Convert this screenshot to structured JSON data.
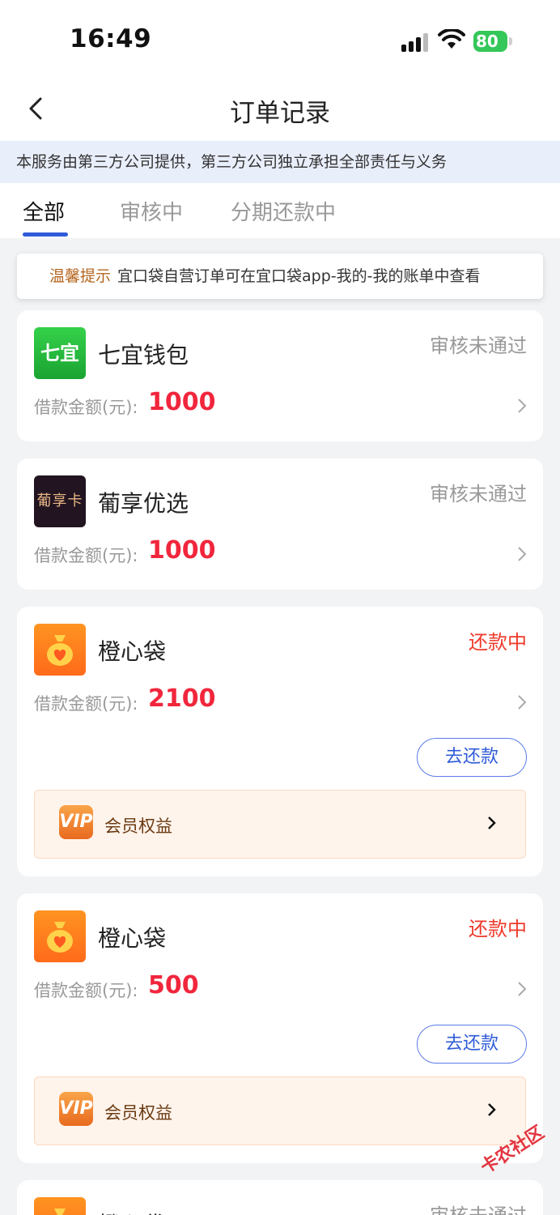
{
  "status_bar": {
    "time": "16:49",
    "battery": "80"
  },
  "nav": {
    "title": "订单记录"
  },
  "notice": "本服务由第三方公司提供，第三方公司独立承担全部责任与义务",
  "tabs": [
    {
      "label": "全部",
      "active": true
    },
    {
      "label": "审核中",
      "active": false
    },
    {
      "label": "分期还款中",
      "active": false
    }
  ],
  "tip": {
    "label": "温馨提示",
    "text": "宜口袋自营订单可在宜口袋app-我的-我的账单中查看"
  },
  "amount_label": "借款金额(元):",
  "orders": [
    {
      "name": "七宜钱包",
      "logo_text": "七宜",
      "status": "审核未通过",
      "amount": "1000"
    },
    {
      "name": "葡享优选",
      "logo_text": "葡享卡",
      "status": "审核未通过",
      "amount": "1000"
    },
    {
      "name": "橙心袋",
      "status": "还款中",
      "amount": "2100",
      "button": "去还款",
      "vip_label": "会员权益",
      "vip_icon_text": "VIP"
    },
    {
      "name": "橙心袋",
      "status": "还款中",
      "amount": "500",
      "button": "去还款",
      "vip_label": "会员权益",
      "vip_icon_text": "VIP"
    },
    {
      "name": "橙心袋",
      "status": "审核未通过"
    }
  ],
  "watermark": "卡农社区",
  "colors": {
    "accent": "#2f5bd8",
    "amount": "#f1263c",
    "status_red": "#ef3a2b"
  }
}
